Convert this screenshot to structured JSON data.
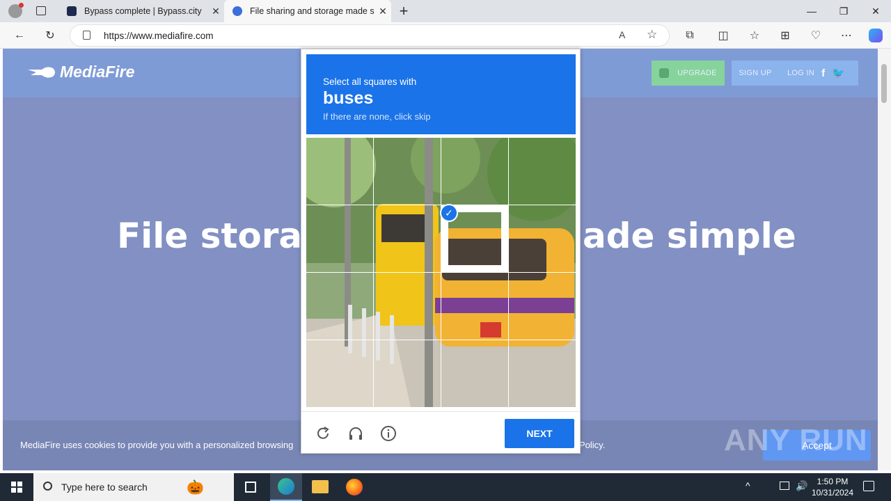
{
  "browser": {
    "tabs": [
      {
        "label": "Bypass complete | Bypass.city",
        "active": false
      },
      {
        "label": "File sharing and storage made sir",
        "active": true
      }
    ],
    "url": "https://www.mediafire.com",
    "new_tab": "+",
    "close": "✕",
    "minimize": "—",
    "restore": "❐"
  },
  "mediafire": {
    "logo": "MediaFire",
    "upgrade": "UPGRADE",
    "signup": "SIGN UP",
    "login": "LOG IN",
    "hero_left": "File storag",
    "hero_right": "ade simple",
    "cookie_text": "MediaFire uses cookies to provide you with a personalized browsing",
    "cookie_end": "Policy.",
    "accept": "Accept"
  },
  "captcha": {
    "instruction": "Select all squares with",
    "target": "buses",
    "hint": "If there are none, click skip",
    "next": "NEXT",
    "selected_cell": 6
  },
  "taskbar": {
    "search_placeholder": "Type here to search",
    "time": "1:50 PM",
    "date": "10/31/2024"
  },
  "colors": {
    "captcha_blue": "#1a73e8",
    "page_overlay": "#8290c3"
  },
  "watermark": "ANY RUN"
}
